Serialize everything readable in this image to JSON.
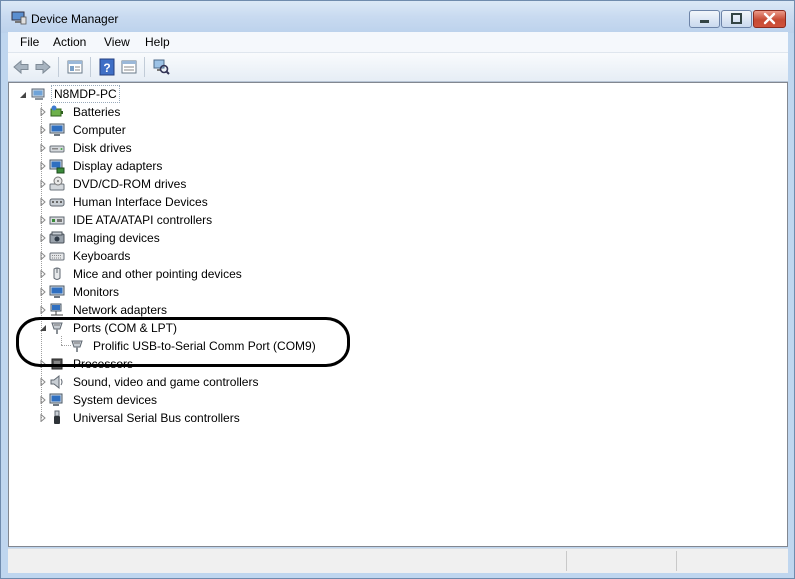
{
  "window": {
    "title": "Device Manager",
    "title_icon": "device-manager-icon",
    "controls": [
      "minimize",
      "maximize",
      "close"
    ]
  },
  "menu": [
    "File",
    "Action",
    "View",
    "Help"
  ],
  "toolbar": {
    "icons": [
      "back-arrow-icon",
      "forward-arrow-icon",
      "properties-icon",
      "help-icon",
      "show-hidden-icon",
      "scan-hardware-icon"
    ]
  },
  "tree": {
    "root": {
      "label": "N8MDP-PC",
      "icon": "computer-icon",
      "expanded": true
    },
    "items": [
      {
        "label": "Batteries",
        "icon": "battery-icon",
        "expanded": false
      },
      {
        "label": "Computer",
        "icon": "monitor-icon",
        "expanded": false
      },
      {
        "label": "Disk drives",
        "icon": "disk-drive-icon",
        "expanded": false
      },
      {
        "label": "Display adapters",
        "icon": "display-adapter-icon",
        "expanded": false
      },
      {
        "label": "DVD/CD-ROM drives",
        "icon": "dvd-drive-icon",
        "expanded": false
      },
      {
        "label": "Human Interface Devices",
        "icon": "hid-icon",
        "expanded": false
      },
      {
        "label": "IDE ATA/ATAPI controllers",
        "icon": "ide-controller-icon",
        "expanded": false
      },
      {
        "label": "Imaging devices",
        "icon": "imaging-icon",
        "expanded": false
      },
      {
        "label": "Keyboards",
        "icon": "keyboard-icon",
        "expanded": false
      },
      {
        "label": "Mice and other pointing devices",
        "icon": "mouse-icon",
        "expanded": false
      },
      {
        "label": "Monitors",
        "icon": "monitor-icon",
        "expanded": false
      },
      {
        "label": "Network adapters",
        "icon": "network-adapter-icon",
        "expanded": false
      },
      {
        "label": "Ports (COM & LPT)",
        "icon": "port-icon",
        "expanded": true,
        "children": [
          {
            "label": "Prolific USB-to-Serial Comm Port (COM9)",
            "icon": "port-icon"
          }
        ]
      },
      {
        "label": "Processors",
        "icon": "processor-icon",
        "expanded": false
      },
      {
        "label": "Sound, video and game controllers",
        "icon": "sound-icon",
        "expanded": false
      },
      {
        "label": "System devices",
        "icon": "system-device-icon",
        "expanded": false
      },
      {
        "label": "Universal Serial Bus controllers",
        "icon": "usb-icon",
        "expanded": false
      }
    ]
  },
  "colors": {
    "titlebar": "#c8daf0",
    "close_button": "#c64a33",
    "highlight_ring": "#000000"
  }
}
